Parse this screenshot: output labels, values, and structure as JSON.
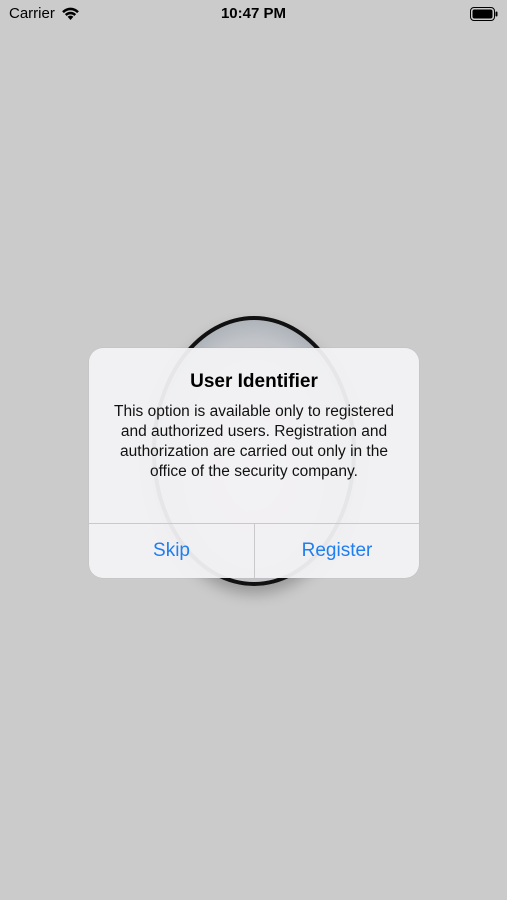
{
  "status_bar": {
    "carrier": "Carrier",
    "time": "10:47 PM",
    "wifi_icon": "wifi-icon",
    "battery_icon": "battery-icon"
  },
  "alert": {
    "title": "User Identifier",
    "message": "This option is available only to registered and authorized users. Registration and authorization are carried out only in the office of the security company.",
    "buttons": {
      "skip": "Skip",
      "register": "Register"
    },
    "button_color": "#1f7ef0"
  },
  "background": {
    "color": "#cbcbcb"
  }
}
